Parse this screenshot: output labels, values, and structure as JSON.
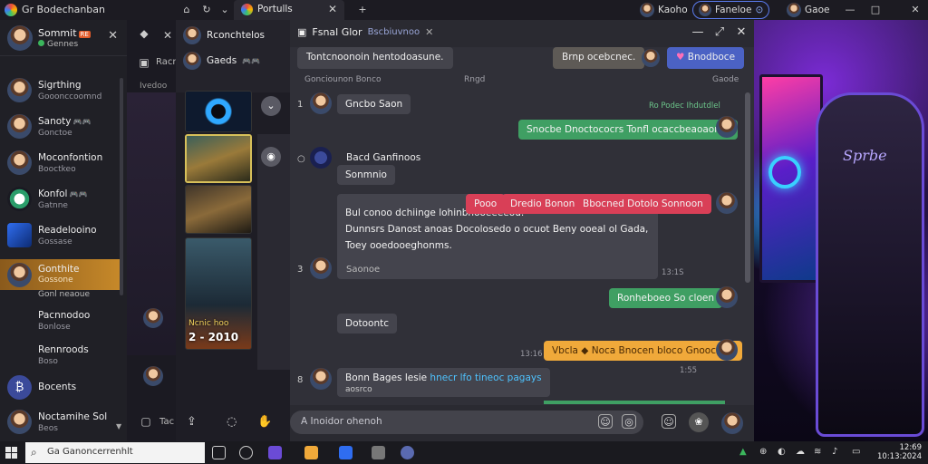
{
  "app": {
    "title": "Gr Bodechanban"
  },
  "tabs": [
    {
      "label": "Portulls",
      "close": "✕"
    }
  ],
  "new_tab": "+",
  "top_users": [
    {
      "name": "Kaoho"
    },
    {
      "name": "Faneloe"
    },
    {
      "name": "Gaoe"
    }
  ],
  "me": {
    "name": "Sommit",
    "badge": "RE",
    "status": "Gennes",
    "close": "✕"
  },
  "contacts": [
    {
      "name": "Sigrthing",
      "sub": "Gooonccoomnd"
    },
    {
      "name": "Sanoty",
      "emoji": "🎮🎮",
      "sub": "Gonctoe"
    },
    {
      "name": "Moconfontion",
      "sub": "Booctkeo"
    },
    {
      "name": "Konfol",
      "emoji": "🎮🎮",
      "sub": "Gatnne"
    },
    {
      "name": "Readelooino",
      "sub": "Gossase"
    },
    {
      "name": "Gonthite",
      "sub": "Gossone",
      "extra": "Gonl neaoue"
    },
    {
      "name": "Pacnnodoo",
      "sub": "Bonlose"
    },
    {
      "name": "Rennroods",
      "sub": "Boso"
    },
    {
      "name": "Bocents"
    },
    {
      "name": "Noctamihe Sol",
      "sub": "Beos"
    }
  ],
  "mid": {
    "label_top": "Racr",
    "label_mid": "Ivedoo",
    "label_bottom": "Tac"
  },
  "gallery": {
    "users": [
      {
        "name": "Rconchtelos"
      },
      {
        "name": "Gaeds",
        "emoji": "🎮🎮"
      }
    ],
    "caption": "Ncnic hoo",
    "number": "2 - 2010"
  },
  "chat": {
    "title": "Fsnal Glor",
    "subtitle": "Bscbiuvnoo",
    "pinned": "Tontcnoonoin hentodoasune.",
    "pill_right": "Brnp ocebcnec.",
    "pill_heart": "Bnodboce",
    "col_left": "Gonciounon Bonco",
    "col_mid": "Rngd",
    "col_right": "Gaode",
    "messages": [
      {
        "idx": "1",
        "text": "Gncbo Saon",
        "meta": ""
      },
      {
        "text": "Snocbe Dnoctococrs Tonfl ocaccbeaoaonat",
        "meta": "Ro Podec Ihdutdlel"
      },
      {
        "idx": "",
        "text": "Bacd Ganfinoos"
      },
      {
        "text": "Sonmnio"
      },
      {
        "text_l1": "Bul conoo dchiinge lohinbnooeeeeou.",
        "text_l2": "Dunnsrs Danost anoas Docolosedo o ocuot Beny ooeal ol Gada,",
        "text_l3": "Toey ooedooeghonms."
      },
      {
        "tag1": "Pooo",
        "tag2": "Dredio Bonon",
        "tag3": "Bbocned Dotolo Sonnoon"
      },
      {
        "idx": "3",
        "text": "Saonoe",
        "meta": "13:1S"
      },
      {
        "text": "Ronheboeo So cloen"
      },
      {
        "text": "Dotoontc"
      },
      {
        "text": "Vbcla ◆ Noca Bnocen bloco Gnoocoen",
        "meta": "13:16",
        "meta2": "1:55"
      },
      {
        "idx": "8",
        "text_a": "Bonn Bages lesie",
        "text_link": "hnecr lfo tineoc pagays",
        "text_b": "aosrco"
      }
    ],
    "composer_placeholder": "A Inoidor ohenoh"
  },
  "taskbar": {
    "search_placeholder": "Ga Ganoncerrenhlt",
    "time": "12:69",
    "date": "10:13:2024"
  },
  "wallpaper": {
    "chair_text": "Sprbe"
  }
}
